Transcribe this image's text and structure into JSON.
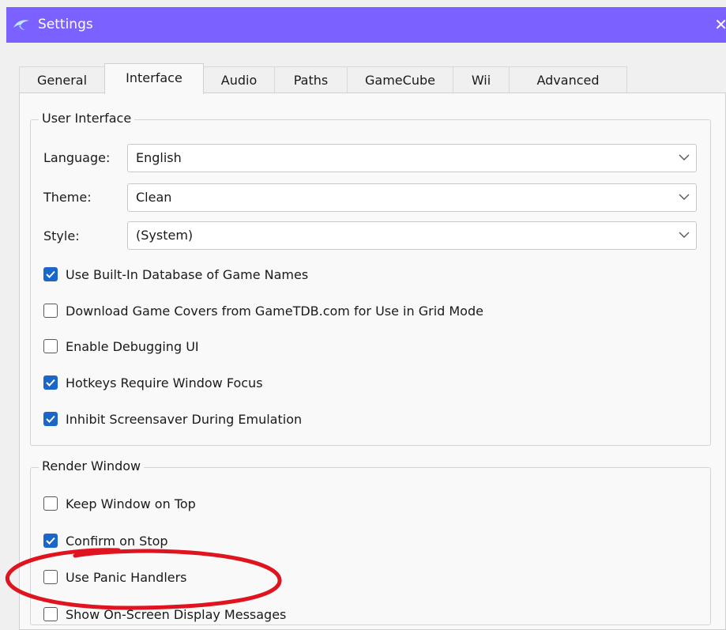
{
  "window": {
    "title": "Settings",
    "close_glyph": "✕",
    "icon": "dolphin-icon",
    "title_bar_color": "#7b61ff",
    "accent_color": "#1a66c9"
  },
  "tabs": [
    {
      "label": "General",
      "active": false
    },
    {
      "label": "Interface",
      "active": true
    },
    {
      "label": "Audio",
      "active": false
    },
    {
      "label": "Paths",
      "active": false
    },
    {
      "label": "GameCube",
      "active": false
    },
    {
      "label": "Wii",
      "active": false
    },
    {
      "label": "Advanced",
      "active": false
    }
  ],
  "user_interface": {
    "title": "User Interface",
    "language": {
      "label": "Language:",
      "value": "English"
    },
    "theme": {
      "label": "Theme:",
      "value": "Clean"
    },
    "style": {
      "label": "Style:",
      "value": "(System)"
    },
    "checkboxes": [
      {
        "label": "Use Built-In Database of Game Names",
        "checked": true
      },
      {
        "label": "Download Game Covers from GameTDB.com for Use in Grid Mode",
        "checked": false
      },
      {
        "label": "Enable Debugging UI",
        "checked": false
      },
      {
        "label": "Hotkeys Require Window Focus",
        "checked": true
      },
      {
        "label": "Inhibit Screensaver During Emulation",
        "checked": true
      }
    ]
  },
  "render_window": {
    "title": "Render Window",
    "checkboxes": [
      {
        "label": "Keep Window on Top",
        "checked": false
      },
      {
        "label": "Confirm on Stop",
        "checked": true
      },
      {
        "label": "Use Panic Handlers",
        "checked": false
      },
      {
        "label": "Show On-Screen Display Messages",
        "checked": false
      }
    ]
  },
  "annotation": {
    "color": "#e0141e"
  }
}
